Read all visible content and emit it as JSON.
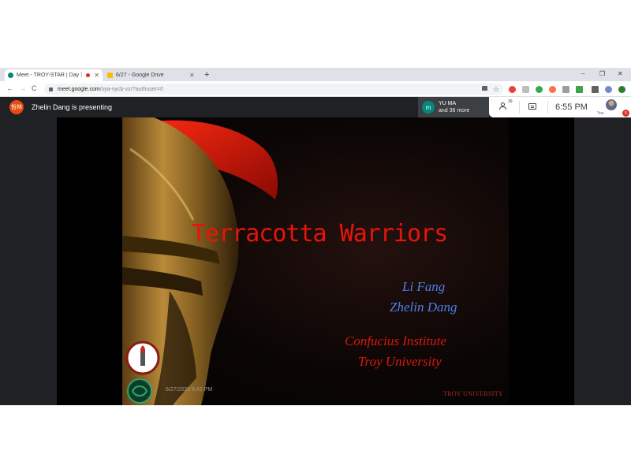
{
  "browser": {
    "tabs": [
      {
        "title": "Meet - TROY-STAR | Day 1",
        "favicon_color": "#00897b",
        "recording": true
      },
      {
        "title": "6/27 - Google Drive",
        "favicon_color": "#fbbc04",
        "recording": false
      }
    ],
    "new_tab_label": "+",
    "window_controls": {
      "minimize": "–",
      "restore": "❐",
      "close": "✕"
    },
    "nav": {
      "back": "←",
      "forward": "→",
      "reload": "C"
    },
    "address": {
      "host": "meet.google.com",
      "path": "/sya-vycb-vzr?authuser=0"
    },
    "star_icon": "☆"
  },
  "meet": {
    "presenter_avatar_text": "哲林",
    "presenting_text": "Zhelin Dang is presenting",
    "participant": {
      "avatar_letter": "m",
      "name": "YU MA",
      "more": "and 36 more"
    },
    "people_count": "39",
    "clock": "6:55  PM",
    "self_label": "You",
    "badge": "5"
  },
  "slide": {
    "title": "Terracotta Warriors",
    "authors": [
      "Li Fang",
      "Zhelin Dang"
    ],
    "institute": [
      "Confucius Institute",
      "Troy University"
    ],
    "timestamp": "6/27/2020 6:42 PM",
    "mark": "TROY UNIVERSITY"
  },
  "colors": {
    "title_red": "#e8140b",
    "author_blue": "#4f7ee8",
    "meet_dark": "#202124"
  }
}
